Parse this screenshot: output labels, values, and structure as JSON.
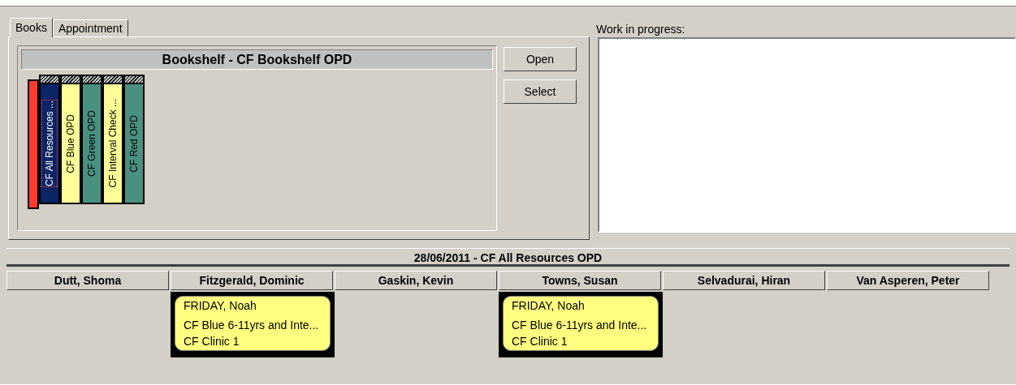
{
  "tabs": [
    {
      "label": "Books",
      "selected": true
    },
    {
      "label": "Appointment",
      "selected": false
    }
  ],
  "bookshelf": {
    "title": "Bookshelf - CF Bookshelf OPD",
    "books": [
      {
        "label": "CF All Resources ...",
        "color": "#0a2466",
        "selected": true
      },
      {
        "label": "CF Blue OPD",
        "color": "#ffff99",
        "selected": false
      },
      {
        "label": "CF Green OPD",
        "color": "#4a9080",
        "selected": false
      },
      {
        "label": "CF Interval Check ...",
        "color": "#ffff99",
        "selected": false
      },
      {
        "label": "CF Red OPD",
        "color": "#4a9080",
        "selected": false
      }
    ]
  },
  "buttons": [
    "Open",
    "Select"
  ],
  "work_in_progress": {
    "label": "Work in progress:"
  },
  "schedule": {
    "title": "28/06/2011 - CF All Resources OPD",
    "columns": [
      {
        "name": "Dutt, Shoma"
      },
      {
        "name": "Fitzgerald, Dominic",
        "appointments": [
          {
            "patient": "FRIDAY, Noah",
            "clinic": "CF Blue 6-11yrs and Inte...",
            "location": "CF Clinic 1"
          }
        ]
      },
      {
        "name": "Gaskin, Kevin"
      },
      {
        "name": "Towns, Susan",
        "appointments": [
          {
            "patient": "FRIDAY, Noah",
            "clinic": "CF Blue 6-11yrs and Inte...",
            "location": "CF Clinic 1"
          }
        ]
      },
      {
        "name": "Selvadurai, Hiran"
      },
      {
        "name": "Van Asperen, Peter"
      }
    ]
  }
}
